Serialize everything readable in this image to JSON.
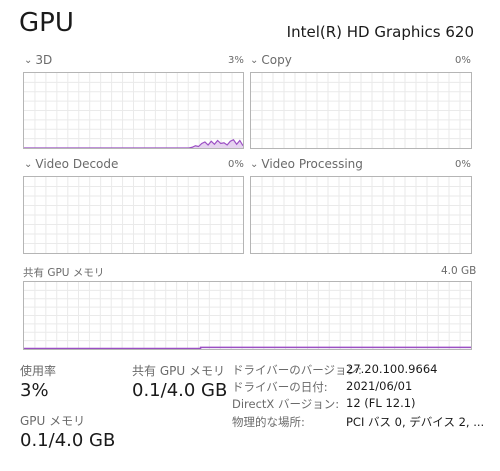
{
  "header": {
    "title": "GPU",
    "model": "Intel(R) HD Graphics 620"
  },
  "engines": [
    {
      "name": "3D",
      "pct": "3%"
    },
    {
      "name": "Copy",
      "pct": "0%"
    },
    {
      "name": "Video Decode",
      "pct": "0%"
    },
    {
      "name": "Video Processing",
      "pct": "0%"
    }
  ],
  "shared_memory": {
    "label": "共有 GPU メモリ",
    "max": "4.0 GB"
  },
  "stats": {
    "usage": {
      "label": "使用率",
      "value": "3%"
    },
    "shared": {
      "label": "共有 GPU メモリ",
      "value": "0.1/4.0 GB"
    },
    "dedicated": {
      "label": "GPU メモリ",
      "value": "0.1/4.0 GB"
    }
  },
  "details": [
    {
      "key": "ドライバーのバージョン:",
      "value": "27.20.100.9664"
    },
    {
      "key": "ドライバーの日付:",
      "value": "2021/06/01"
    },
    {
      "key": "DirectX バージョン:",
      "value": "12 (FL 12.1)"
    },
    {
      "key": "物理的な場所:",
      "value": "PCI バス 0, デバイス 2, ..."
    }
  ],
  "colors": {
    "accent": "#9b4fc4",
    "accent_fill": "#e6d3f0",
    "grid": "#eaeaea",
    "border": "#b5b5b5"
  },
  "activity_3d": [
    0,
    0,
    0,
    0,
    0,
    0,
    0,
    0,
    0,
    0,
    0,
    0,
    0,
    0,
    0,
    0,
    0,
    0,
    0,
    0,
    0,
    0,
    0,
    0,
    0,
    0,
    0,
    0,
    0,
    0,
    0,
    0,
    0,
    0,
    0,
    0,
    0,
    0,
    0,
    0,
    0,
    0,
    0,
    0,
    0,
    0,
    0,
    0,
    0,
    0,
    0,
    0,
    0,
    1,
    3,
    2,
    6,
    8,
    4,
    9,
    5,
    10,
    6,
    7,
    4,
    9,
    11,
    5,
    10,
    3
  ],
  "shared_memory_fraction_after_jump": 0.025
}
